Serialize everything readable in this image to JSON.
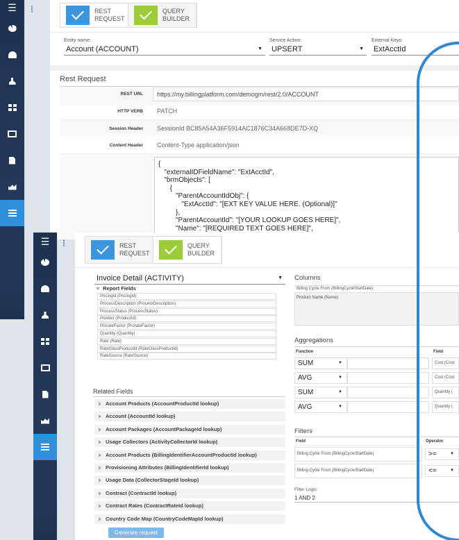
{
  "window_back": {
    "tabs": [
      {
        "label": "REST REQUEST",
        "color": "blue"
      },
      {
        "label": "QUERY BUILDER",
        "color": "green"
      }
    ],
    "entity_label": "Entity name:",
    "entity_value": "Account (ACCOUNT)",
    "service_label": "Service Action:",
    "service_value": "UPSERT",
    "keys_label": "External Keys:",
    "keys_value": "ExtAcctId",
    "section_title": "Rest Request",
    "rows": [
      {
        "label": "REST URL",
        "value": "https://my.billingplatform.com/demogm/rest/2.0/ACCOUNT"
      },
      {
        "label": "HTTP VERB",
        "value": "PATCH"
      },
      {
        "label": "Session Header",
        "value": "SessionId BC85A54A36F5914AC1876C34A668DE7D-XQ"
      },
      {
        "label": "Content Header",
        "value": "Content-Type application/json"
      }
    ],
    "code": "{\n   \"externalIDFieldName\": \"ExtAcctId\",\n   \"brmObjects\": [\n      {\n         \"ParentAccountIdObj\": {\n            \"ExtAcctId\": \"[EXT KEY VALUE HERE. (Optional)]\"\n         },\n         \"ParentAccountId\": \"[YOUR LOOKUP GOES HERE]\",\n         \"Name\": \"[REQUIRED TEXT GOES HERE]\",\n         \"Status\": \"[REQUIRED RADIO_GROUP_HORIZONTAL GOES HERE]\","
  },
  "window_front": {
    "tabs": [
      {
        "label": "REST REQUEST",
        "color": "blue"
      },
      {
        "label": "QUERY BUILDER",
        "color": "green"
      }
    ],
    "entity_value": "Invoice Detail (ACTIVITY)",
    "report_fields_title": "Report Fields",
    "report_fields": [
      "PricingId (PricingId)",
      "ProcessDescription (ProcessDescription)",
      "ProcessStatus (ProcessStatus)",
      "Product (ProductId)",
      "ProrateFactor (ProrateFactor)",
      "Quantity (Quantity)",
      "Rate (Rate)",
      "RateClassProductId (RateClassProductId)",
      "RateSource (RateSource)"
    ],
    "related_title": "Related Fields",
    "related_fields": [
      "Account Products (AccountProductId lookup)",
      "Account (AccountId lookup)",
      "Account Packages (AccountPackageId lookup)",
      "Usage Collectors (ActivityCollectorId lookup)",
      "Account Products (BillingIdentifierAccountProductId lookup)",
      "Provisioning Attributes (BillingIdentifierId lookup)",
      "Usage Data (CollectorStageId lookup)",
      "Contract (ContractId lookup)",
      "Contract Rates (ContractRateId lookup)",
      "Country Code Map (CountryCodeMapId lookup)"
    ],
    "columns_title": "Columns",
    "columns": [
      "Billing Cycle From (BillingCycleStartDate)",
      "Product Name (Name)"
    ],
    "aggregations_title": "Aggregations",
    "agg_head_function": "Function",
    "agg_head_field": "Field",
    "aggregations": [
      {
        "fn": "SUM",
        "field": "Cost (Cost"
      },
      {
        "fn": "AVG",
        "field": "Cost (Cost"
      },
      {
        "fn": "SUM",
        "field": "Quantity ("
      },
      {
        "fn": "AVG",
        "field": "Quantity ("
      }
    ],
    "filters_title": "Filters",
    "filter_head_field": "Field",
    "filter_head_operator": "Operator",
    "filters": [
      {
        "field": "Billing Cycle From (BillingCycleStartDate)",
        "op": ">="
      },
      {
        "field": "Billing Cycle From (BillingCycleStartDate)",
        "op": "<="
      }
    ],
    "filter_logic_label": "Filter Logic:",
    "filter_logic_value": "1 AND 2",
    "generate_label": "Generate request"
  },
  "icons": [
    "pie-chart-icon",
    "gauge-icon",
    "user-icon",
    "grid-icon",
    "card-icon",
    "document-icon",
    "area-chart-icon",
    "table-icon"
  ]
}
